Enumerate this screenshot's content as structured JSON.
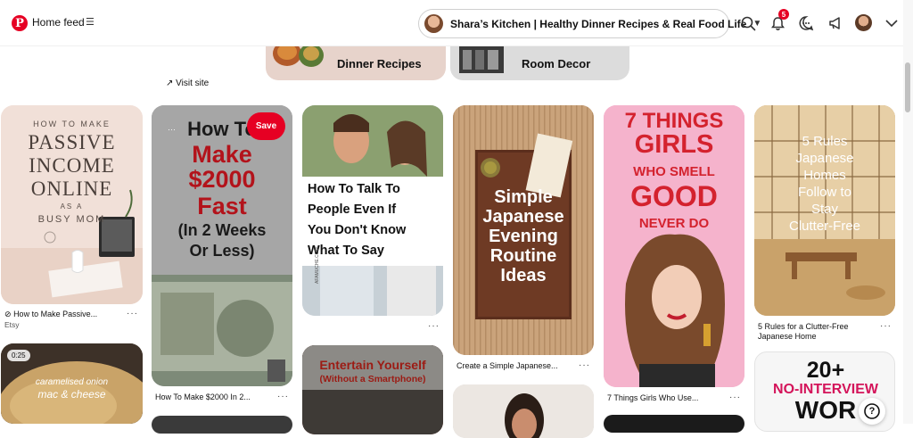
{
  "header": {
    "feed_label": "Home feed",
    "board_title": "Shara’s Kitchen | Healthy Dinner Recipes & Real Food Life",
    "notification_count": "5"
  },
  "boards": [
    {
      "name": "Dinner Recipes"
    },
    {
      "name": "Room Decor"
    }
  ],
  "visit_site": "Visit site",
  "save_label": "Save",
  "more": "···",
  "help": "?",
  "pins": {
    "passive": {
      "art": [
        "HOW TO MAKE",
        "PASSIVE",
        "INCOME",
        "ONLINE",
        "AS A",
        "BUSY MOM"
      ],
      "caption": "How to Make Passive...",
      "source": "Etsy"
    },
    "money": {
      "art": [
        "How To",
        "Make",
        "$2000",
        "Fast",
        "(In 2 Weeks",
        "Or Less)"
      ],
      "caption": "How To Make $2000 In 2..."
    },
    "talk": {
      "art": [
        "How To Talk To",
        "People Even If",
        "You Don't Know",
        "What To Say"
      ],
      "watermark": "AFAMUCHE.COM"
    },
    "japanese_routine": {
      "art": [
        "Simple",
        "Japanese",
        "Evening",
        "Routine",
        "Ideas"
      ],
      "caption": "Create a Simple Japanese..."
    },
    "girls": {
      "art": [
        "7 THINGS",
        "GIRLS",
        "WHO SMELL",
        "GOOD",
        "NEVER DO"
      ],
      "caption": "7 Things Girls Who Use..."
    },
    "clutter": {
      "art": [
        "5 Rules",
        "Japanese",
        "Homes",
        "Follow to",
        "Stay",
        "Clutter-Free"
      ],
      "caption": "5 Rules for a Clutter-Free",
      "caption2": "Japanese Home"
    },
    "mac": {
      "duration": "0:25",
      "art": [
        "caramelised onion",
        "mac & cheese"
      ]
    },
    "entertain": {
      "art": [
        "Entertain Yourself",
        "(Without a Smartphone)"
      ]
    },
    "interview": {
      "art": [
        "20+",
        "NO-INTERVIEW",
        "WOR"
      ]
    }
  },
  "colors": {
    "brand": "#e60023"
  }
}
